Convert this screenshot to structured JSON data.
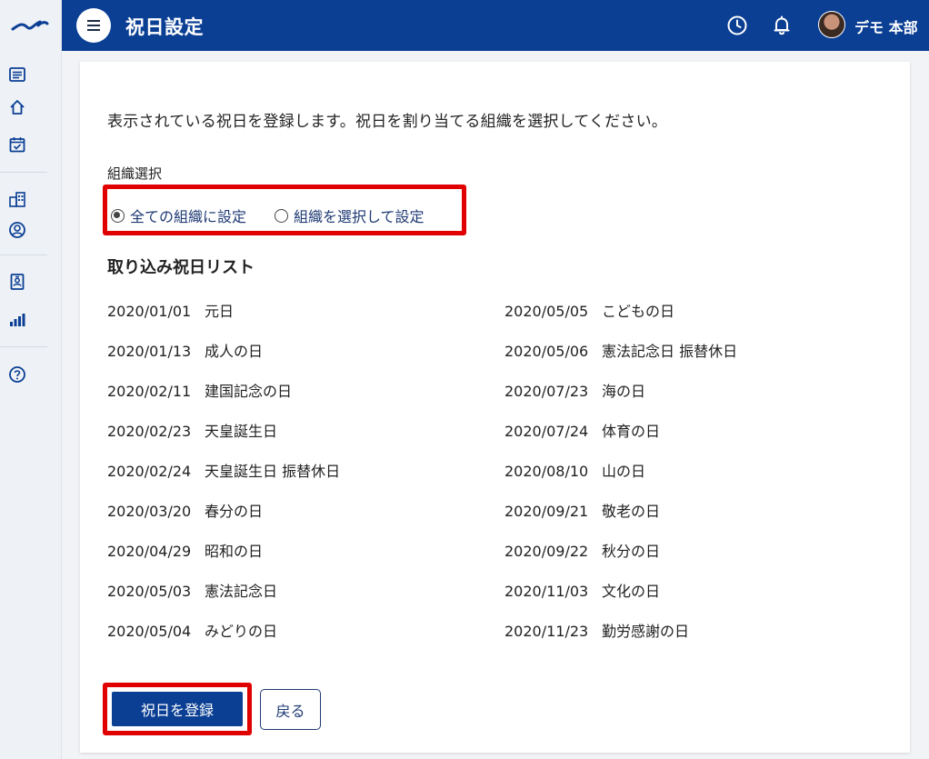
{
  "header": {
    "title": "祝日設定",
    "user_name": "デモ 本部",
    "colors": {
      "brand": "#0b3f94",
      "highlight": "#e00000"
    }
  },
  "sidebar": {
    "icons": [
      "list-icon",
      "home-icon",
      "calendar-check-icon",
      "building-icon",
      "user-circle-icon",
      "id-badge-icon",
      "bar-chart-icon",
      "help-icon"
    ]
  },
  "main": {
    "intro": "表示されている祝日を登録します。祝日を割り当てる組織を選択してください。",
    "org_select_label": "組織選択",
    "radio_all": "全ての組織に設定",
    "radio_select": "組織を選択して設定",
    "radio_selected": "all",
    "list_title": "取り込み祝日リスト",
    "holidays_left": [
      {
        "date": "2020/01/01",
        "name": "元日"
      },
      {
        "date": "2020/01/13",
        "name": "成人の日"
      },
      {
        "date": "2020/02/11",
        "name": "建国記念の日"
      },
      {
        "date": "2020/02/23",
        "name": "天皇誕生日"
      },
      {
        "date": "2020/02/24",
        "name": "天皇誕生日 振替休日"
      },
      {
        "date": "2020/03/20",
        "name": "春分の日"
      },
      {
        "date": "2020/04/29",
        "name": "昭和の日"
      },
      {
        "date": "2020/05/03",
        "name": "憲法記念日"
      },
      {
        "date": "2020/05/04",
        "name": "みどりの日"
      }
    ],
    "holidays_right": [
      {
        "date": "2020/05/05",
        "name": "こどもの日"
      },
      {
        "date": "2020/05/06",
        "name": "憲法記念日 振替休日"
      },
      {
        "date": "2020/07/23",
        "name": "海の日"
      },
      {
        "date": "2020/07/24",
        "name": "体育の日"
      },
      {
        "date": "2020/08/10",
        "name": "山の日"
      },
      {
        "date": "2020/09/21",
        "name": "敬老の日"
      },
      {
        "date": "2020/09/22",
        "name": "秋分の日"
      },
      {
        "date": "2020/11/03",
        "name": "文化の日"
      },
      {
        "date": "2020/11/23",
        "name": "勤労感謝の日"
      }
    ],
    "register_button": "祝日を登録",
    "back_button": "戻る"
  }
}
